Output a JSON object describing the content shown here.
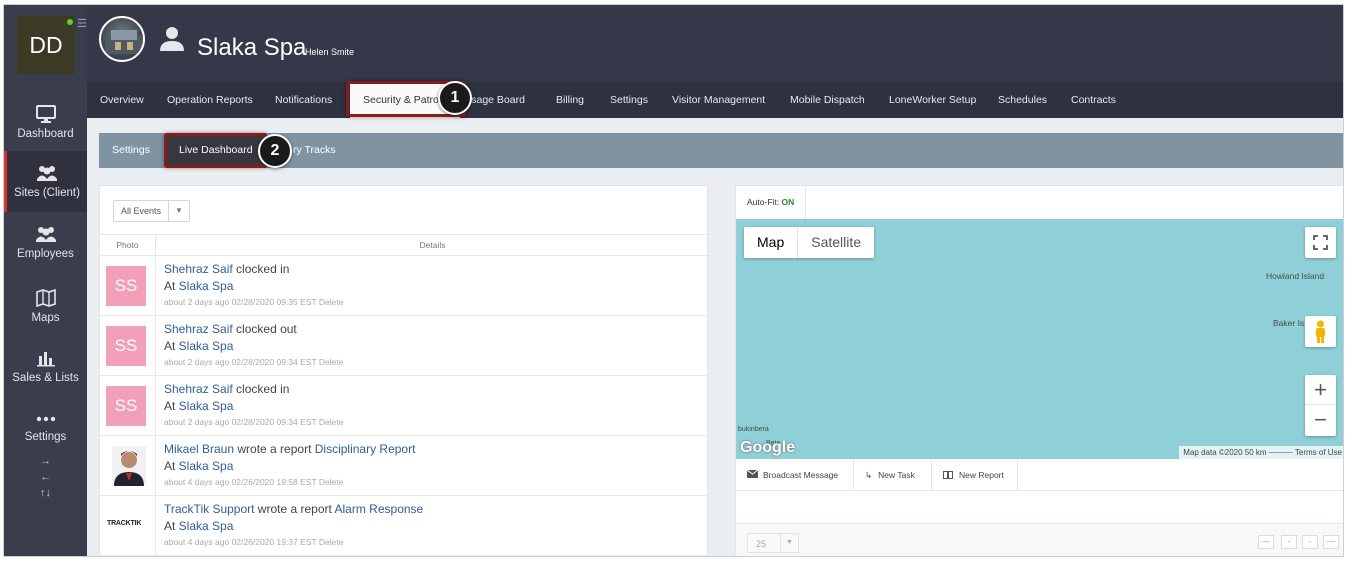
{
  "sidebar": {
    "initials": "DD",
    "items": [
      {
        "label": "Dashboard",
        "icon": "monitor-icon"
      },
      {
        "label": "Sites (Client)",
        "icon": "people-group-icon",
        "active": true
      },
      {
        "label": "Employees",
        "icon": "people-group-icon"
      },
      {
        "label": "Maps",
        "icon": "map-icon"
      },
      {
        "label": "Sales & Lists",
        "icon": "bar-chart-icon"
      },
      {
        "label": "Settings",
        "icon": "dots-icon"
      }
    ],
    "arrows": [
      "→",
      "←",
      "↑↓"
    ]
  },
  "header": {
    "title": "Slaka Spa",
    "subtitle": "Helen Smite"
  },
  "tabs": [
    {
      "label": "Overview"
    },
    {
      "label": "Operation Reports"
    },
    {
      "label": "Notifications"
    },
    {
      "label": "Security & Patrol",
      "active": true
    },
    {
      "label": "ssage Board"
    },
    {
      "label": "Billing"
    },
    {
      "label": "Settings"
    },
    {
      "label": "Visitor Management"
    },
    {
      "label": "Mobile Dispatch"
    },
    {
      "label": "LoneWorker Setup"
    },
    {
      "label": "Schedules"
    },
    {
      "label": "Contracts"
    }
  ],
  "subtabs": [
    {
      "label": "Settings"
    },
    {
      "label": "Live Dashboard",
      "active": true
    },
    {
      "label": "ry Tracks"
    }
  ],
  "annotations": [
    "1",
    "2"
  ],
  "events": {
    "filter_label": "All Events",
    "col_photo": "Photo",
    "col_details": "Details",
    "rows": [
      {
        "photo": "SS",
        "actor": "Shehraz Saif",
        "action": " clocked in",
        "target": "",
        "at": "At ",
        "site": "Slaka Spa",
        "meta": "about 2 days ago   02/28/2020 09:35 EST Delete"
      },
      {
        "photo": "SS",
        "actor": "Shehraz Saif",
        "action": " clocked out",
        "target": "",
        "at": "At ",
        "site": "Slaka Spa",
        "meta": "about 2 days ago   02/28/2020 09:34 EST Delete"
      },
      {
        "photo": "SS",
        "actor": "Shehraz Saif",
        "action": " clocked in",
        "target": "",
        "at": "At ",
        "site": "Slaka Spa",
        "meta": "about 2 days ago   02/28/2020 09:34 EST Delete"
      },
      {
        "photo": "",
        "actor": "Mikael Braun",
        "action": " wrote a report ",
        "target": "Disciplinary Report",
        "at": "At ",
        "site": "Slaka Spa",
        "meta": "about 4 days ago   02/26/2020 19:58 EST Delete"
      },
      {
        "photo": "TRACKTIK",
        "actor": "TrackTik Support",
        "action": " wrote a report ",
        "target": "Alarm Response",
        "at": "At ",
        "site": "Slaka Spa",
        "meta": "about 4 days ago   02/26/2020 19:37 EST Delete"
      }
    ]
  },
  "map": {
    "autofit_label": "Auto-Fit: ",
    "autofit_value": "ON",
    "type_map": "Map",
    "type_satellite": "Satellite",
    "labels": {
      "howland": "Howland Island",
      "baker": "Baker Is",
      "bukinbera": "bukinbera",
      "beta": "Beta"
    },
    "google": "Google",
    "footer": "Map data ©2020   50 km ⎯⎯⎯⎯⎯⎯   Terms of Use",
    "actions": [
      {
        "label": "Broadcast Message",
        "icon": "envelope-icon"
      },
      {
        "label": "New Task",
        "icon": "task-arrow-icon"
      },
      {
        "label": "New Report",
        "icon": "book-icon"
      }
    ],
    "page_size": "25"
  },
  "colors": {
    "accent": "#8b1a1a",
    "header": "#353849",
    "sidebar": "#3a3d4b",
    "subtabs": "#7f93a3"
  }
}
